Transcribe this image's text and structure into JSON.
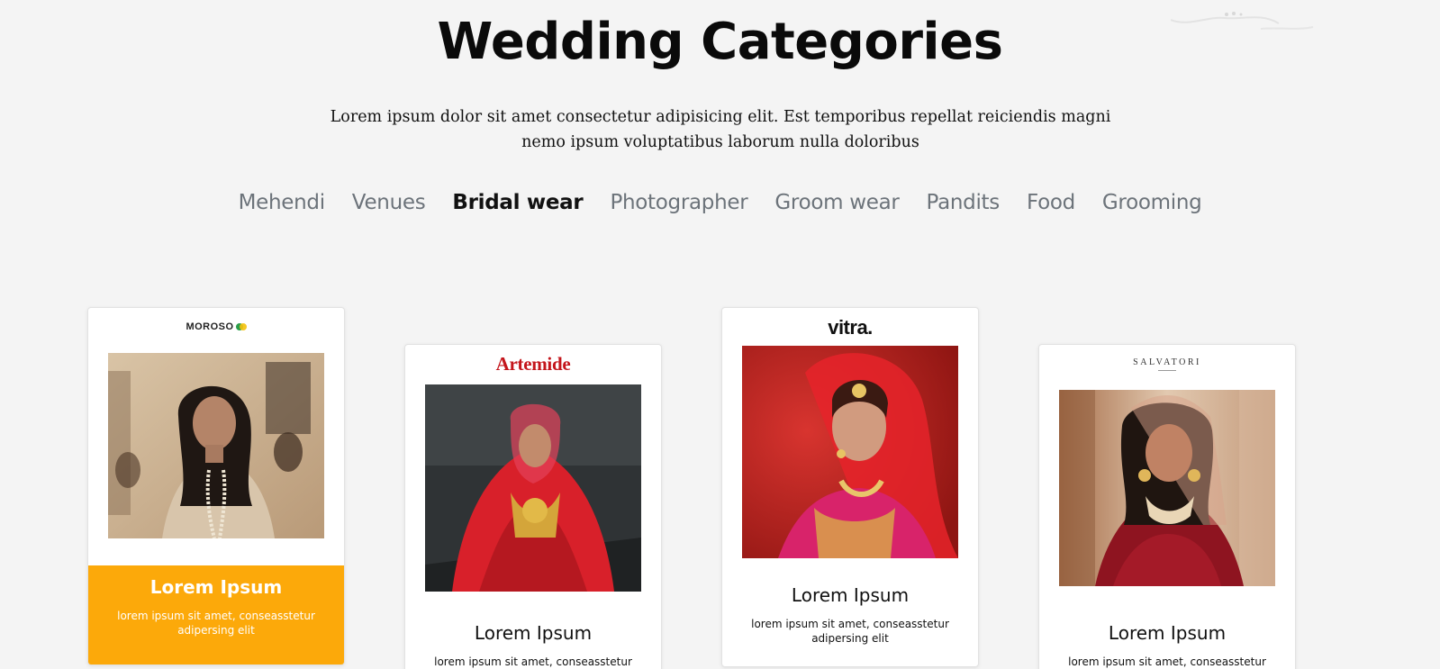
{
  "header": {
    "title": "Wedding Categories",
    "intro": "Lorem ipsum dolor sit amet consectetur adipisicing elit. Est temporibus repellat reiciendis magni nemo ipsum voluptatibus laborum nulla doloribus"
  },
  "tabs": [
    {
      "label": "Mehendi",
      "active": false
    },
    {
      "label": "Venues",
      "active": false
    },
    {
      "label": "Bridal wear",
      "active": true
    },
    {
      "label": "Photographer",
      "active": false
    },
    {
      "label": "Groom wear",
      "active": false
    },
    {
      "label": "Pandits",
      "active": false
    },
    {
      "label": "Food",
      "active": false
    },
    {
      "label": "Grooming",
      "active": false
    }
  ],
  "cards": [
    {
      "brand": "MOROSO",
      "title": "Lorem Ipsum",
      "text": "lorem ipsum sit amet, conseasstetur adipersing elit",
      "highlight": true
    },
    {
      "brand": "Artemide",
      "title": "Lorem Ipsum",
      "text": "lorem ipsum sit amet, conseasstetur adipersing elit",
      "highlight": false
    },
    {
      "brand": "vitra.",
      "title": "Lorem Ipsum",
      "text": "lorem ipsum sit amet, conseasstetur adipersing elit",
      "highlight": false
    },
    {
      "brand": "SALVATORI",
      "title": "Lorem Ipsum",
      "text": "lorem ipsum sit amet, conseasstetur adipersing elit",
      "highlight": false
    }
  ],
  "colors": {
    "accent": "#fca90a",
    "background": "#f4f4f4",
    "tab_inactive": "#6c737a",
    "artemide_red": "#c4161c"
  }
}
